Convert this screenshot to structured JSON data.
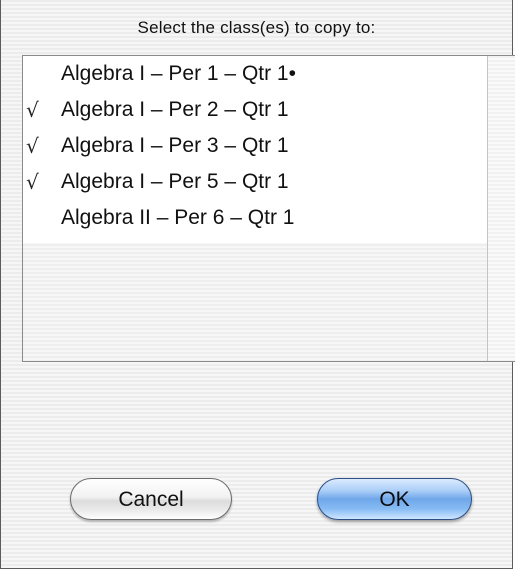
{
  "dialog": {
    "prompt": "Select the class(es) to copy to:",
    "cancel_label": "Cancel",
    "ok_label": "OK"
  },
  "classes": [
    {
      "label": "Algebra I – Per 1 – Qtr 1•",
      "checked": false,
      "mark": ""
    },
    {
      "label": "Algebra I – Per 2 – Qtr 1",
      "checked": true,
      "mark": "√"
    },
    {
      "label": "Algebra I – Per 3 – Qtr 1",
      "checked": true,
      "mark": "√"
    },
    {
      "label": "Algebra I – Per 5 – Qtr 1",
      "checked": true,
      "mark": "√"
    },
    {
      "label": "Algebra II – Per 6 – Qtr 1",
      "checked": false,
      "mark": ""
    }
  ],
  "colors": {
    "ok_button_accent": "#6fa7ea",
    "list_background": "#ffffff"
  }
}
